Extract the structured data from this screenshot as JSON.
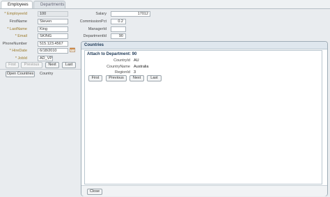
{
  "tabs": [
    {
      "label": "Employees",
      "active": true
    },
    {
      "label": "Departments",
      "active": false
    }
  ],
  "form": {
    "left": {
      "employee_id": {
        "label": "EmployeeId",
        "value": "100",
        "required": true
      },
      "first_name": {
        "label": "FirstName",
        "value": "Steven",
        "required": false
      },
      "last_name": {
        "label": "LastName",
        "value": "King",
        "required": true
      },
      "email": {
        "label": "Email",
        "value": "SKING",
        "required": true
      },
      "phone": {
        "label": "PhoneNumber",
        "value": "515.123.4567",
        "required": false
      },
      "hire_date": {
        "label": "HireDate",
        "value": "6/18/2010",
        "required": true
      },
      "job_id": {
        "label": "JobId",
        "value": "AD_VP",
        "required": true
      }
    },
    "right": {
      "salary": {
        "label": "Salary",
        "value": "17012"
      },
      "commission": {
        "label": "CommissionPct",
        "value": "0.2"
      },
      "manager": {
        "label": "ManagerId",
        "value": ""
      },
      "department": {
        "label": "DepartmentId",
        "value": "90"
      }
    },
    "required_mark": "*"
  },
  "nav": {
    "first": "First",
    "previous": "Previous",
    "next": "Next",
    "last": "Last"
  },
  "open_countries_label": "Open Countries",
  "country_label": "Country",
  "popup": {
    "title": "Countries",
    "section_title": "Attach to Department: 90",
    "fields": {
      "country_id": {
        "label": "CountryId",
        "value": "AU"
      },
      "country_name": {
        "label": "CountryName",
        "value": "Australia"
      },
      "region_id": {
        "label": "RegionId",
        "value": "3"
      }
    },
    "nav": {
      "first": "First",
      "previous": "Previous",
      "next": "Next",
      "last": "Last"
    },
    "close_label": "Close"
  },
  "colors": {
    "required_label": "#9b7a2a",
    "popup_header": "#dfe7ee",
    "popup_title": "#1f3a57"
  },
  "icons": {
    "hire_date_picker": "calendar-icon"
  }
}
